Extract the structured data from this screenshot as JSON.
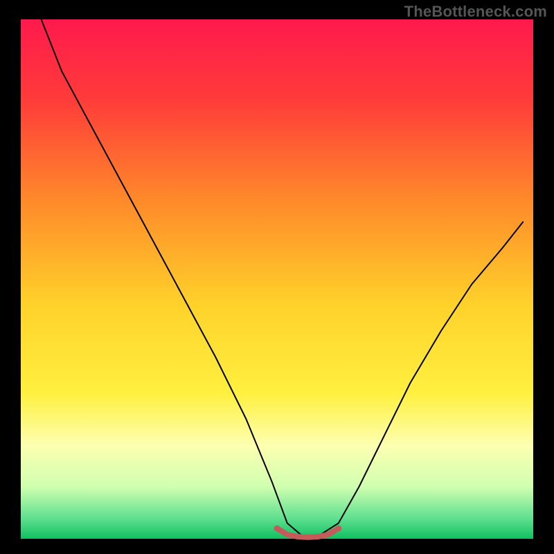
{
  "watermark": "TheBottleneck.com",
  "chart_data": {
    "type": "line",
    "title": "",
    "xlabel": "",
    "ylabel": "",
    "xlim": [
      0,
      100
    ],
    "ylim": [
      0,
      100
    ],
    "background_gradient": {
      "stops": [
        {
          "offset": 0.0,
          "color": "#ff1a4d"
        },
        {
          "offset": 0.15,
          "color": "#ff3a3a"
        },
        {
          "offset": 0.35,
          "color": "#ff8a2a"
        },
        {
          "offset": 0.55,
          "color": "#ffd22a"
        },
        {
          "offset": 0.72,
          "color": "#fff040"
        },
        {
          "offset": 0.82,
          "color": "#fdffb0"
        },
        {
          "offset": 0.9,
          "color": "#d0ffb0"
        },
        {
          "offset": 0.96,
          "color": "#60e090"
        },
        {
          "offset": 1.0,
          "color": "#10c060"
        }
      ]
    },
    "series": [
      {
        "name": "bottleneck-curve",
        "color": "#000000",
        "width": 2,
        "x": [
          4,
          8,
          14,
          20,
          26,
          32,
          38,
          44,
          49,
          52,
          55,
          58,
          62,
          66,
          70,
          76,
          82,
          88,
          94,
          98
        ],
        "y": [
          100,
          90,
          79,
          68,
          57,
          46,
          35,
          23,
          11,
          3,
          0.5,
          0.5,
          3,
          10,
          18,
          30,
          40,
          49,
          56,
          61
        ]
      },
      {
        "name": "valley-marker",
        "color": "#c55a5a",
        "width": 8,
        "x": [
          50,
          52,
          54,
          56,
          58,
          60,
          62
        ],
        "y": [
          2.0,
          0.8,
          0.4,
          0.3,
          0.4,
          0.8,
          2.0
        ]
      }
    ]
  }
}
